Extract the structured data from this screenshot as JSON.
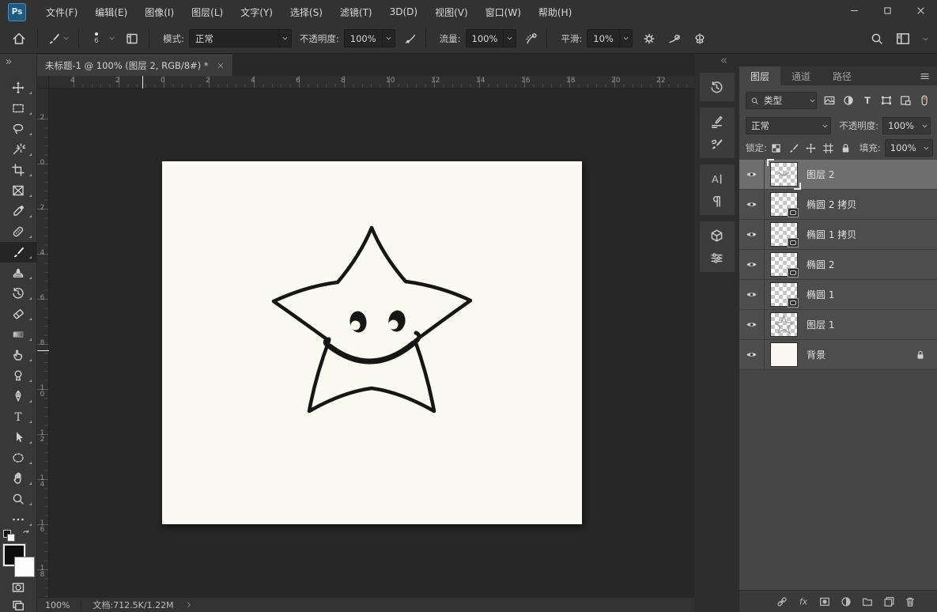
{
  "menu_bar": {
    "logo": "Ps",
    "items": [
      {
        "label": "文件(F)"
      },
      {
        "label": "编辑(E)"
      },
      {
        "label": "图像(I)"
      },
      {
        "label": "图层(L)"
      },
      {
        "label": "文字(Y)"
      },
      {
        "label": "选择(S)"
      },
      {
        "label": "滤镜(T)"
      },
      {
        "label": "3D(D)"
      },
      {
        "label": "视图(V)"
      },
      {
        "label": "窗口(W)"
      },
      {
        "label": "帮助(H)"
      }
    ]
  },
  "options_bar": {
    "brush_size": "6",
    "mode_label": "模式:",
    "mode_value": "正常",
    "opacity_label": "不透明度:",
    "opacity_value": "100%",
    "flow_label": "流量:",
    "flow_value": "100%",
    "smoothing_label": "平滑:",
    "smoothing_value": "10%"
  },
  "document_tab": {
    "title": "未标题-1 @ 100% (图层 2, RGB/8#) *"
  },
  "toolbar": {
    "tools": [
      {
        "id": "move"
      },
      {
        "id": "marquee"
      },
      {
        "id": "lasso"
      },
      {
        "id": "magic-wand"
      },
      {
        "id": "crop"
      },
      {
        "id": "frame"
      },
      {
        "id": "eyedropper"
      },
      {
        "id": "healing"
      },
      {
        "id": "brush",
        "selected": true
      },
      {
        "id": "stamp"
      },
      {
        "id": "history-brush"
      },
      {
        "id": "eraser"
      },
      {
        "id": "gradient"
      },
      {
        "id": "smudge"
      },
      {
        "id": "dodge"
      },
      {
        "id": "pen"
      },
      {
        "id": "type"
      },
      {
        "id": "path-select"
      },
      {
        "id": "shape"
      },
      {
        "id": "hand"
      },
      {
        "id": "zoom"
      },
      {
        "id": "ellipsis"
      }
    ]
  },
  "rulers": {
    "horizontal_labels": [
      "4",
      "2",
      "0",
      "2",
      "4",
      "6",
      "8",
      "10",
      "12",
      "14",
      "16",
      "18",
      "20",
      "22"
    ],
    "vertical_labels": [
      "2",
      "0",
      "2",
      "4",
      "6",
      "8",
      "10",
      "12",
      "14",
      "16",
      "18"
    ]
  },
  "canvas": {
    "background": "#fbfaf1",
    "drawing": "smiling cartoon star, black outline"
  },
  "panel_strip": {
    "groups": [
      {
        "icons": [
          {
            "id": "history"
          }
        ]
      },
      {
        "icons": [
          {
            "id": "brush-settings"
          },
          {
            "id": "brushes"
          }
        ]
      },
      {
        "icons": [
          {
            "id": "character"
          },
          {
            "id": "paragraph"
          }
        ]
      },
      {
        "icons": [
          {
            "id": "3d"
          },
          {
            "id": "properties"
          }
        ]
      }
    ]
  },
  "layers_panel": {
    "tabs": [
      {
        "label": "图层",
        "active": true
      },
      {
        "label": "通道"
      },
      {
        "label": "路径"
      }
    ],
    "filter_label": "类型",
    "filter_icons": [
      {
        "id": "filter-pic"
      },
      {
        "id": "filter-adj"
      },
      {
        "id": "filter-type"
      },
      {
        "id": "filter-shape"
      },
      {
        "id": "filter-smart"
      },
      {
        "id": "filter-toggle"
      }
    ],
    "blend_mode": "正常",
    "opacity_label": "不透明度:",
    "opacity_value": "100%",
    "lock_label": "锁定:",
    "lock_icons": [
      {
        "id": "lock-transparent"
      },
      {
        "id": "lock-brush"
      },
      {
        "id": "lock-move"
      },
      {
        "id": "lock-artboard"
      },
      {
        "id": "lock"
      }
    ],
    "fill_label": "填充:",
    "fill_value": "100%",
    "layers": [
      {
        "name": "图层 2",
        "type": "pixel",
        "selected": true,
        "art": "smile"
      },
      {
        "name": "椭圆 2 拷贝",
        "type": "shape"
      },
      {
        "name": "椭圆 1 拷贝",
        "type": "shape"
      },
      {
        "name": "椭圆 2",
        "type": "shape"
      },
      {
        "name": "椭圆 1",
        "type": "shape"
      },
      {
        "name": "图层 1",
        "type": "pixel",
        "art": "star"
      },
      {
        "name": "背景",
        "type": "background",
        "locked": true
      }
    ],
    "bottom_icons": [
      {
        "id": "link"
      },
      {
        "id": "fx"
      },
      {
        "id": "mask"
      },
      {
        "id": "filter-adj"
      },
      {
        "id": "folder"
      },
      {
        "id": "new-layer"
      },
      {
        "id": "trash"
      }
    ]
  },
  "status_bar": {
    "zoom": "100%",
    "doc_info": "文档:712.5K/1.22M"
  },
  "colors": {
    "logo_blue": "#225a7d",
    "paper": "#fbfaf1",
    "panel": "#464646",
    "selected_row": "#6e6e6e",
    "toggle_red": "#d84b44",
    "ink": "#161616"
  }
}
